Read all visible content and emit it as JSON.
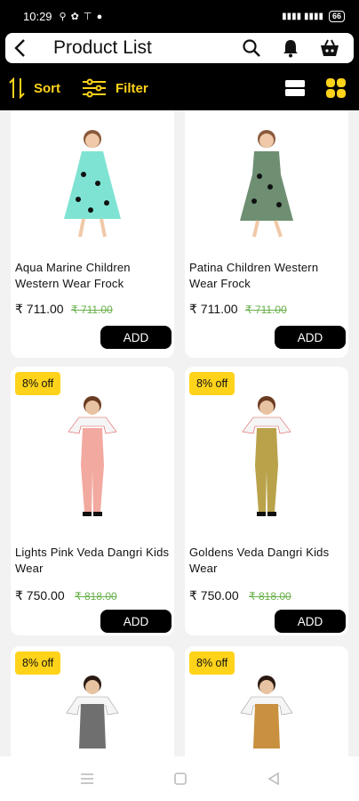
{
  "status": {
    "time": "10:29",
    "battery": "66"
  },
  "header": {
    "title": "Product List"
  },
  "toolbar": {
    "sort_label": "Sort",
    "filter_label": "Filter"
  },
  "products": [
    {
      "name": "Aqua Marine Children Western Wear Frock",
      "price": "₹ 711.00",
      "mrp": "₹ 711.00",
      "badge": "",
      "add": "ADD",
      "dress_color": "#7fe3d3"
    },
    {
      "name": "Patina Children Western Wear Frock",
      "price": "₹ 711.00",
      "mrp": "₹ 711.00",
      "badge": "",
      "add": "ADD",
      "dress_color": "#6e8f72"
    },
    {
      "name": "Lights Pink Veda Dangri Kids Wear",
      "price": "₹ 750.00",
      "mrp": "₹ 818.00",
      "badge": "8% off",
      "add": "ADD",
      "dress_color": "#f2a9a0"
    },
    {
      "name": "Goldens Veda Dangri Kids Wear",
      "price": "₹ 750.00",
      "mrp": "₹ 818.00",
      "badge": "8% off",
      "add": "ADD",
      "dress_color": "#b9a24a"
    },
    {
      "name": "",
      "price": "",
      "mrp": "",
      "badge": "8% off",
      "add": "",
      "dress_color": "#6f6f6f"
    },
    {
      "name": "",
      "price": "",
      "mrp": "",
      "badge": "8% off",
      "add": "",
      "dress_color": "#c8903f"
    }
  ]
}
